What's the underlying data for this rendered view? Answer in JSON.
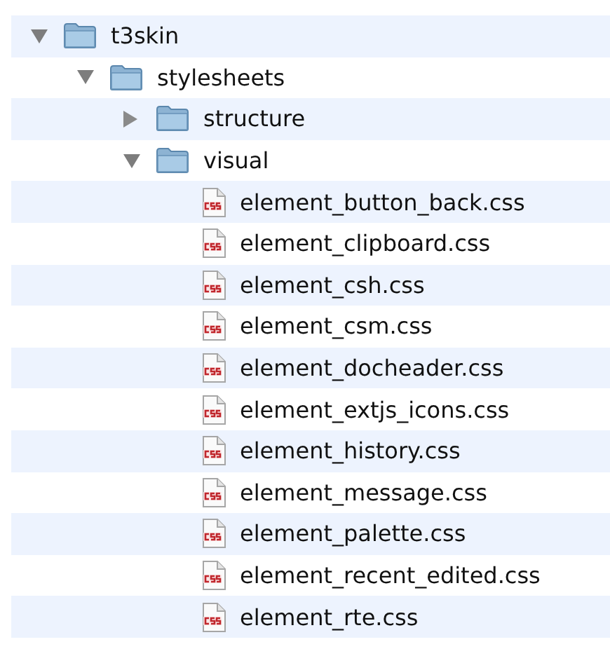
{
  "tree": [
    {
      "kind": "folder",
      "name": "t3skin",
      "expanded": true,
      "children": [
        {
          "kind": "folder",
          "name": "stylesheets",
          "expanded": true,
          "children": [
            {
              "kind": "folder",
              "name": "structure",
              "expanded": false
            },
            {
              "kind": "folder",
              "name": "visual",
              "expanded": true,
              "children": [
                {
                  "kind": "file",
                  "name": "element_button_back.css"
                },
                {
                  "kind": "file",
                  "name": "element_clipboard.css"
                },
                {
                  "kind": "file",
                  "name": "element_csh.css"
                },
                {
                  "kind": "file",
                  "name": "element_csm.css"
                },
                {
                  "kind": "file",
                  "name": "element_docheader.css"
                },
                {
                  "kind": "file",
                  "name": "element_extjs_icons.css"
                },
                {
                  "kind": "file",
                  "name": "element_history.css"
                },
                {
                  "kind": "file",
                  "name": "element_message.css"
                },
                {
                  "kind": "file",
                  "name": "element_palette.css"
                },
                {
                  "kind": "file",
                  "name": "element_recent_edited.css"
                },
                {
                  "kind": "file",
                  "name": "element_rte.css"
                }
              ]
            }
          ]
        }
      ]
    }
  ]
}
